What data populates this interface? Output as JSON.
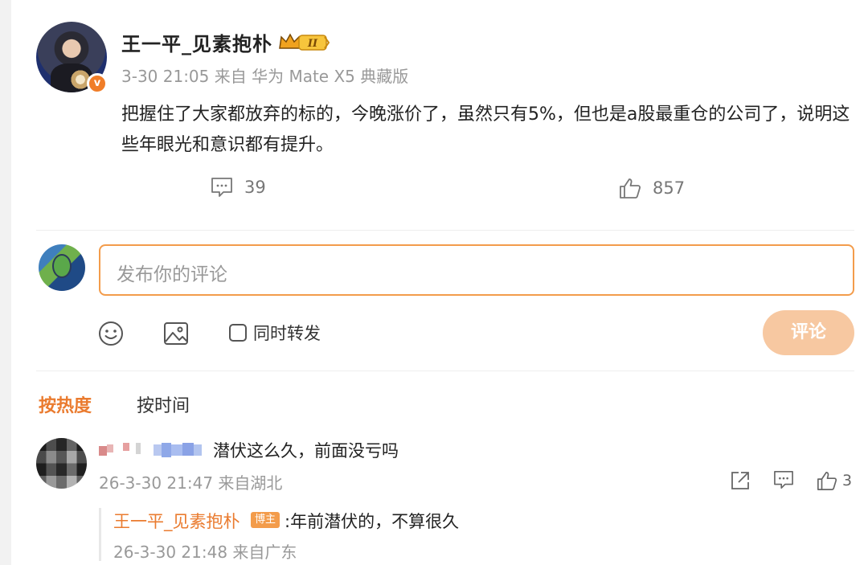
{
  "post": {
    "author": "王一平_见素抱朴",
    "level_badge": "II",
    "meta": "3-30 21:05 来自 华为 Mate X5 典藏版",
    "content": "把握住了大家都放弃的标的，今晚涨价了，虽然只有5%，但也是a股最重仓的公司了，说明这些年眼光和意识都有提升。",
    "comment_count": "39",
    "like_count": "857"
  },
  "composer": {
    "placeholder": "发布你的评论",
    "repost_label": "同时转发",
    "submit_label": "评论"
  },
  "sort_tabs": {
    "hot": "按热度",
    "time": "按时间"
  },
  "comment": {
    "text": "潜伏这么久，前面没亏吗",
    "meta": "26-3-30 21:47 来自湖北",
    "like_count": "3",
    "reply": {
      "author": "王一平_见素抱朴",
      "host_tag": "博主",
      "text": ":年前潜伏的，不算很久",
      "meta": "26-3-30 21:48 来自广东"
    }
  },
  "colors": {
    "accent": "#ea7b2f",
    "input_border": "#f39c4b",
    "submit_disabled": "#f7c8a1",
    "muted": "#999999"
  }
}
